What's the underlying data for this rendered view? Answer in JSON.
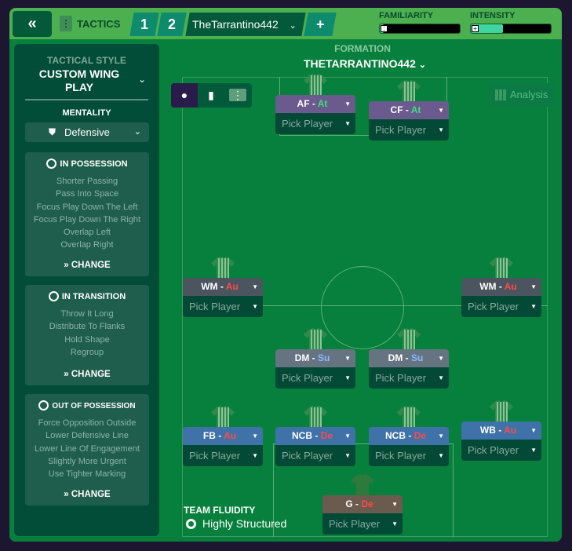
{
  "topbar": {
    "back_icon": "double-chevron-left-icon",
    "tactics_label": "TACTICS",
    "slots": [
      "1",
      "2"
    ],
    "tactic_name": "TheTarrantino442",
    "add_label": "+",
    "familiarity_label": "FAMILIARITY",
    "familiarity_level": 0.05,
    "intensity_label": "INTENSITY",
    "intensity_level": 0.4,
    "accent": "#3fd4a0"
  },
  "sidebar": {
    "style_label": "TACTICAL STYLE",
    "style_value": "CUSTOM WING PLAY",
    "mentality_label": "MENTALITY",
    "mentality_value": "Defensive",
    "sections": [
      {
        "title": "IN POSSESSION",
        "items": [
          "Shorter Passing",
          "Pass Into Space",
          "Focus Play Down The Left",
          "Focus Play Down The Right",
          "Overlap Left",
          "Overlap Right"
        ],
        "change": "CHANGE"
      },
      {
        "title": "IN TRANSITION",
        "items": [
          "Throw It Long",
          "Distribute To Flanks",
          "Hold Shape",
          "Regroup"
        ],
        "change": "CHANGE"
      },
      {
        "title": "OUT OF POSSESSION",
        "items": [
          "Force Opposition Outside",
          "Lower Defensive Line",
          "Lower Line Of Engagement",
          "Slightly More Urgent",
          "Use Tighter Marking"
        ],
        "change": "CHANGE"
      }
    ]
  },
  "formation": {
    "label": "FORMATION",
    "name": "THETARRANTINO442",
    "analysis": "Analysis"
  },
  "players": [
    {
      "pos": "AF",
      "role": "At",
      "pick": "Pick Player",
      "group": "att"
    },
    {
      "pos": "CF",
      "role": "At",
      "pick": "Pick Player",
      "group": "att"
    },
    {
      "pos": "WM",
      "role": "Au",
      "pick": "Pick Player",
      "group": "wm"
    },
    {
      "pos": "WM",
      "role": "Au",
      "pick": "Pick Player",
      "group": "wm"
    },
    {
      "pos": "DM",
      "role": "Su",
      "pick": "Pick Player",
      "group": "dm"
    },
    {
      "pos": "DM",
      "role": "Su",
      "pick": "Pick Player",
      "group": "dm"
    },
    {
      "pos": "FB",
      "role": "Au",
      "pick": "Pick Player",
      "group": "def"
    },
    {
      "pos": "NCB",
      "role": "De",
      "pick": "Pick Player",
      "group": "def"
    },
    {
      "pos": "NCB",
      "role": "De",
      "pick": "Pick Player",
      "group": "def"
    },
    {
      "pos": "WB",
      "role": "Au",
      "pick": "Pick Player",
      "group": "def"
    },
    {
      "pos": "G",
      "role": "De",
      "pick": "Pick Player",
      "group": "gk"
    }
  ],
  "colors": {
    "att": "#6a5a8e",
    "wm": "#4a5560",
    "dm": "#667482",
    "def": "#3f72a8",
    "gk": "#6b5a4e",
    "At": "#39e27b",
    "Au": "#ff4a4a",
    "Su": "#8ab8ff",
    "De": "#ff4a4a"
  },
  "fluidity": {
    "label": "TEAM FLUIDITY",
    "value": "Highly Structured"
  }
}
